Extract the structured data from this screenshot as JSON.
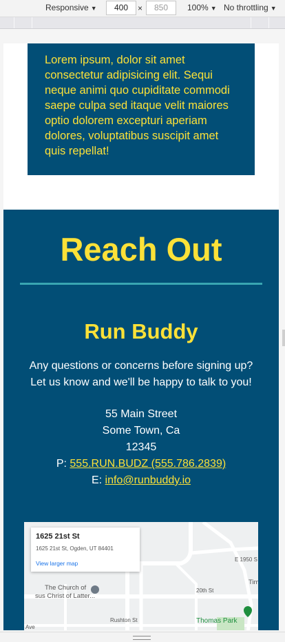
{
  "devtools": {
    "device_mode": "Responsive",
    "width": "400",
    "separator": "×",
    "height": "850",
    "zoom": "100%",
    "throttling": "No throttling",
    "caret": "▼"
  },
  "page": {
    "lorem": "Lorem ipsum, dolor sit amet consectetur adipisicing elit. Sequi neque animi quo cupiditate commodi saepe culpa sed itaque velit maiores optio dolorem excepturi aperiam dolores, voluptatibus suscipit amet quis repellat!",
    "contact": {
      "heading": "Reach Out",
      "company": "Run Buddy",
      "intro_line1": "Any questions or concerns before signing up?",
      "intro_line2": "Let us know and we'll be happy to talk to you!",
      "street": "55 Main Street",
      "city": "Some Town, Ca",
      "zip": "12345",
      "phone_prefix": "P: ",
      "phone_link": "555.RUN.BUDZ (555.786.2839)",
      "email_prefix": "E: ",
      "email_link": "info@runbuddy.io"
    },
    "map": {
      "place_name": "1625 21st St",
      "place_address": "1625 21st St, Ogden, UT 84401",
      "larger_map": "View larger map",
      "church_line1": "The Church of",
      "church_line2": "sus Christ of Latter...",
      "street_20th": "20th St",
      "street_rushton": "Rushton St",
      "street_e1950": "E 1950 S",
      "park": "Thomas Park",
      "label_tim": "Tim",
      "label_ave": "Ave"
    }
  },
  "colors": {
    "brand_blue": "#024e76",
    "brand_yellow": "#fce138",
    "accent_teal": "#39a6b2"
  }
}
